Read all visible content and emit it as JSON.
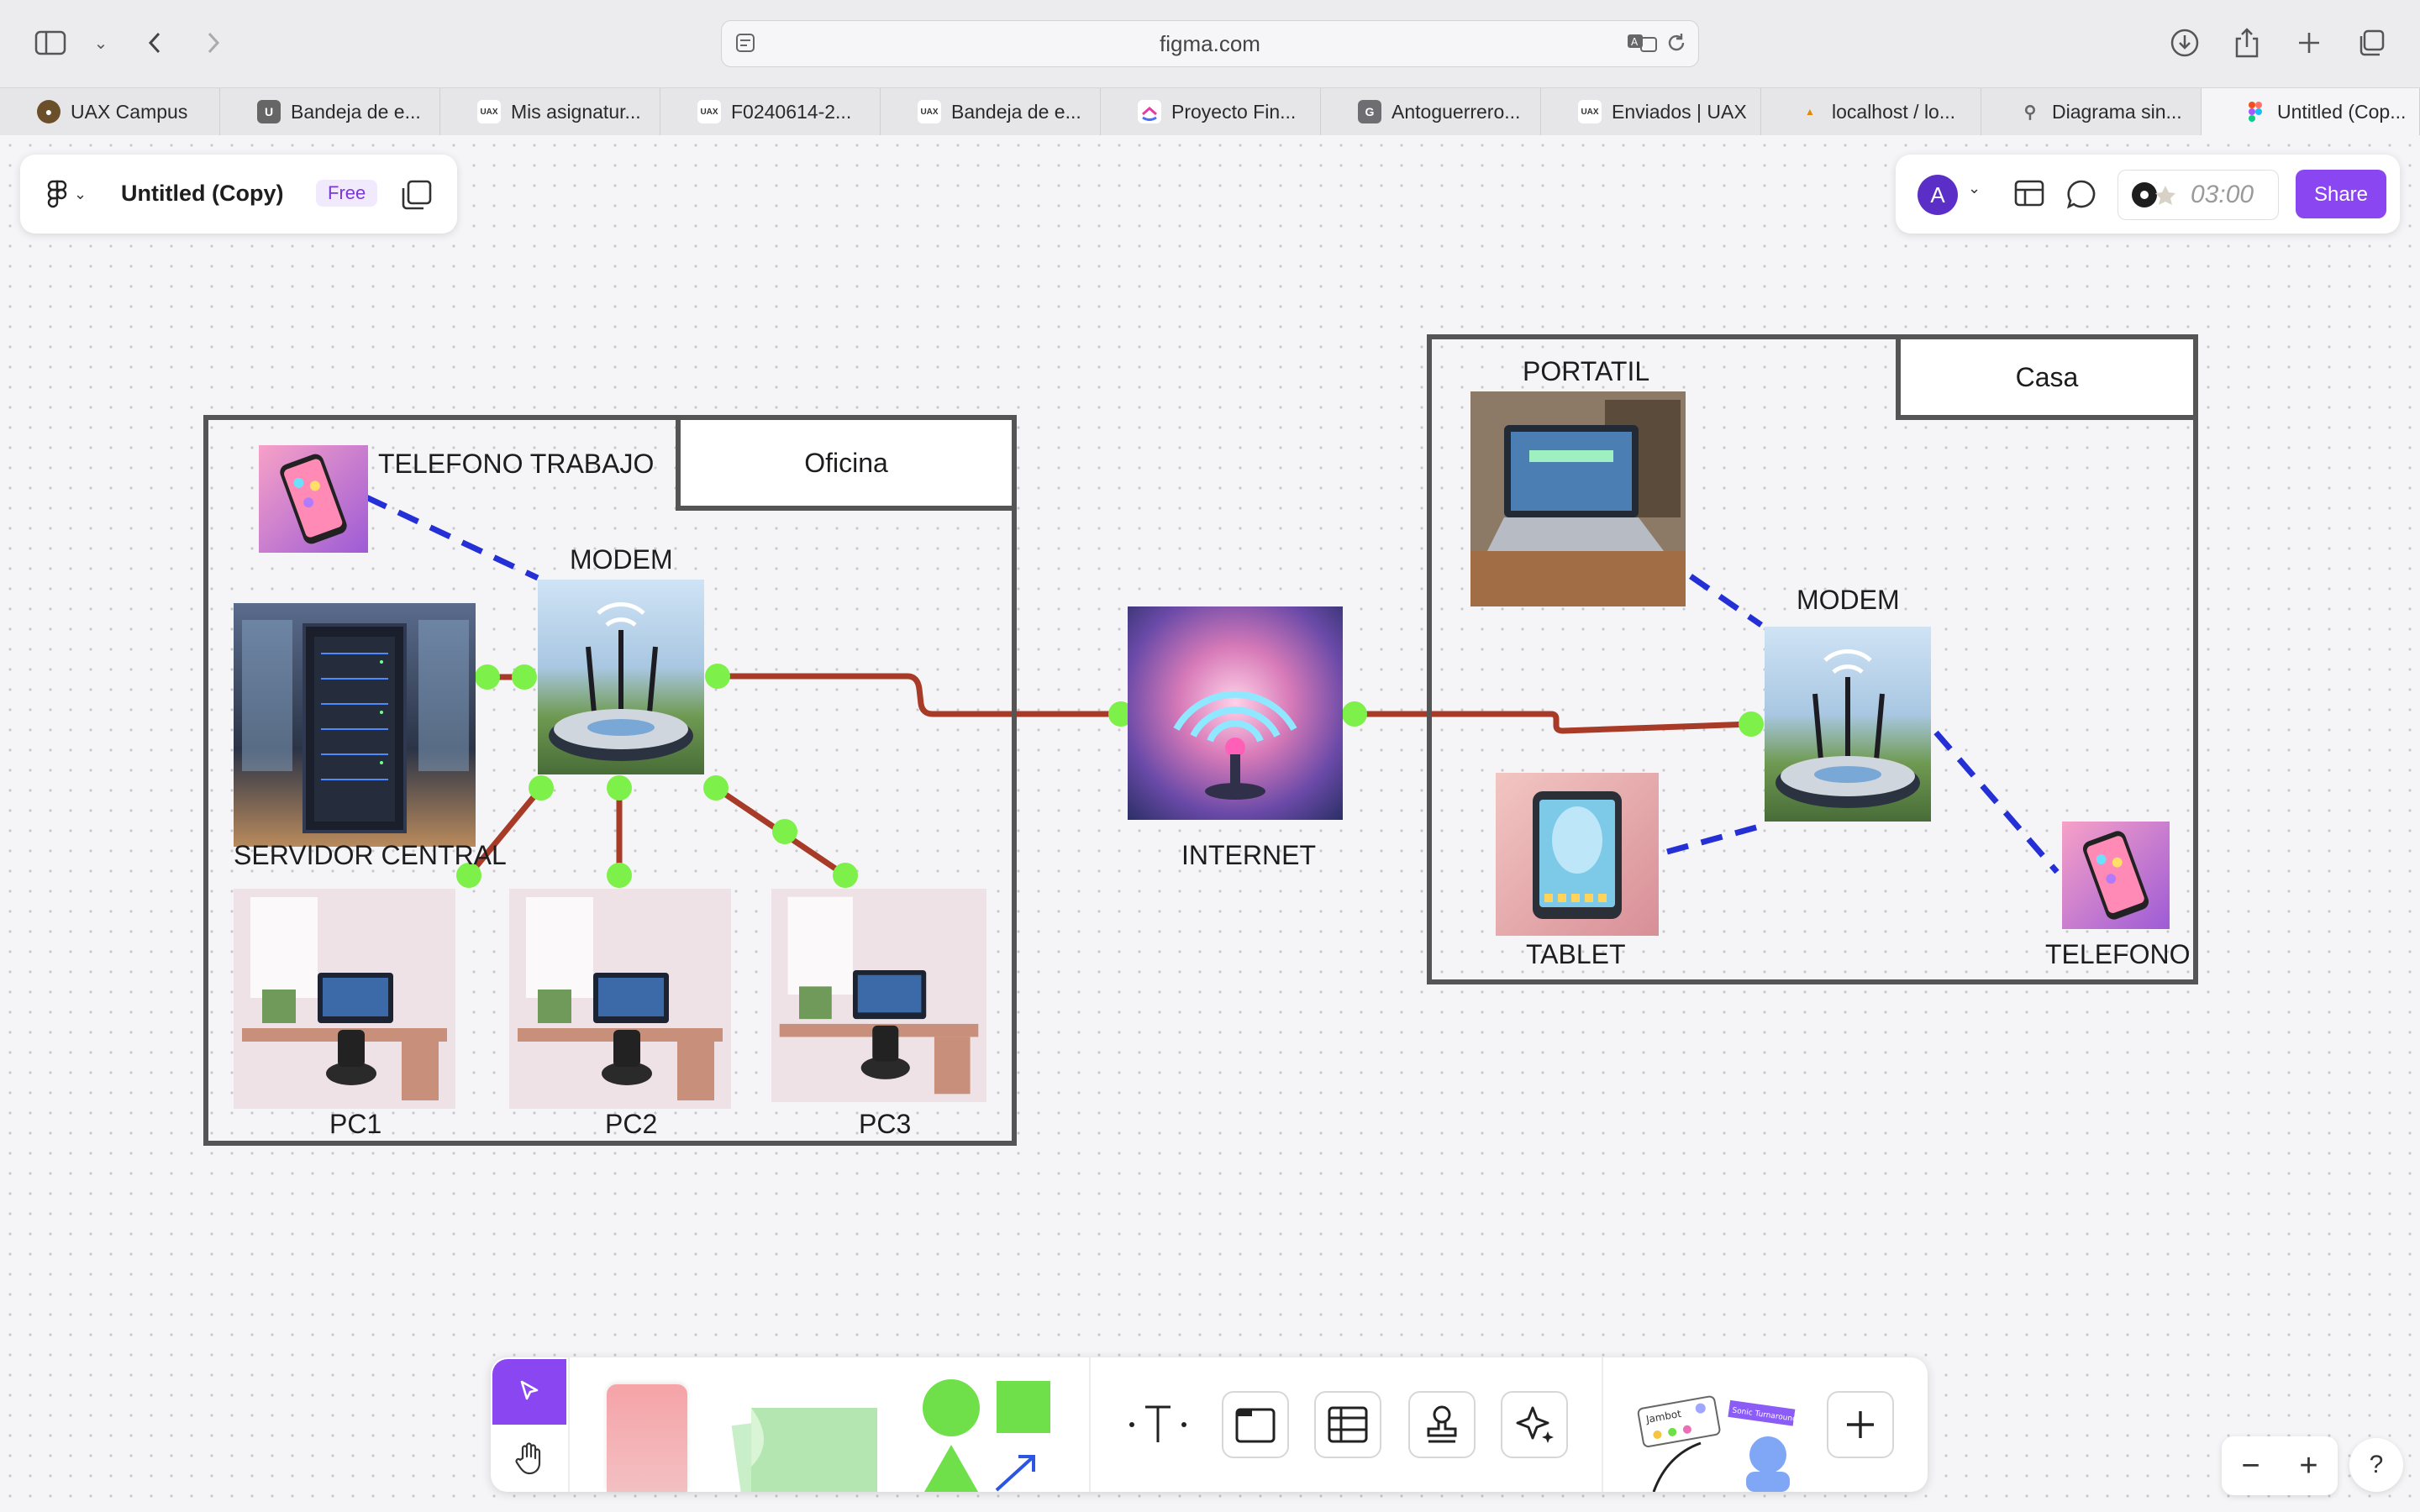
{
  "browser": {
    "url": "figma.com",
    "tabs": [
      {
        "label": "UAX Campus",
        "favicon": "uax-campus-icon"
      },
      {
        "label": "Bandeja de e...",
        "favicon": "u-icon"
      },
      {
        "label": "Mis asignatur...",
        "favicon": "uax-icon"
      },
      {
        "label": "F0240614-2...",
        "favicon": "uax-icon"
      },
      {
        "label": "Bandeja de e...",
        "favicon": "uax-icon"
      },
      {
        "label": "Proyecto Fin...",
        "favicon": "clickup-icon"
      },
      {
        "label": "Antoguerrero...",
        "favicon": "g-icon"
      },
      {
        "label": "Enviados | UAX",
        "favicon": "uax-icon"
      },
      {
        "label": "localhost / lo...",
        "favicon": "phpmyadmin-icon"
      },
      {
        "label": "Diagrama sin...",
        "favicon": "diagram-icon"
      },
      {
        "label": "Untitled (Cop...",
        "favicon": "figma-icon"
      }
    ]
  },
  "file": {
    "title": "Untitled (Copy)",
    "plan_badge": "Free"
  },
  "top_right": {
    "avatar_letter": "A",
    "timer": "03:00",
    "share_label": "Share"
  },
  "diagram": {
    "oficina": {
      "frame_label": "Oficina",
      "labels": {
        "telefono_trabajo": "TELEFONO TRABAJO",
        "modem": "MODEM",
        "servidor": "SERVIDOR CENTRAL",
        "pc1": "PC1",
        "pc2": "PC2",
        "pc3": "PC3"
      }
    },
    "internet_label": "INTERNET",
    "casa": {
      "frame_label": "Casa",
      "labels": {
        "portatil": "PORTATIL",
        "modem": "MODEM",
        "tablet": "TABLET",
        "telefono": "TELEFONO"
      }
    },
    "colors": {
      "cable": "#a83a28",
      "wireless": "#2430d6",
      "connector": "#7df04a",
      "frame_border": "#555555"
    }
  },
  "toolbar": {
    "tools": [
      "move-tool",
      "hand-tool",
      "sticky-note-tool",
      "stickies-pack-tool",
      "shapes-tool",
      "text-tool",
      "section-tool",
      "table-tool",
      "stamp-tool",
      "ai-tool",
      "widgets-tool",
      "more-tool"
    ],
    "widget_caption_1": "Jambot",
    "widget_caption_2": "Sonic Turnaround"
  },
  "zoom": {
    "minus": "−",
    "plus": "+",
    "help": "?"
  }
}
